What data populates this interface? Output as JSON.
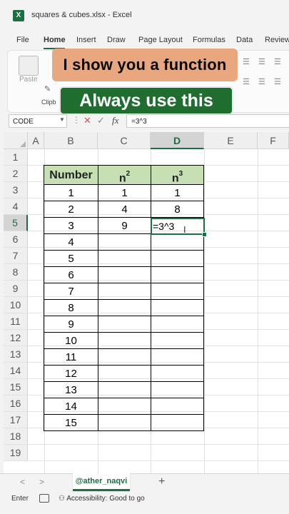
{
  "window": {
    "title": "squares & cubes.xlsx - Excel",
    "app_icon": "excel-logo-icon",
    "logo_letter": "X"
  },
  "menu": {
    "items": [
      "File",
      "Home",
      "Insert",
      "Draw",
      "Page Layout",
      "Formulas",
      "Data",
      "Review"
    ]
  },
  "ribbon": {
    "paste_label": "Paste",
    "clipboard_label": "Clipb"
  },
  "overlay": {
    "line1": "I show you a function",
    "line2": "Always use this"
  },
  "formula_bar": {
    "name_box": "CODE",
    "fx": "fx",
    "formula": "=3^3",
    "cancel": "✕",
    "enter": "✓",
    "dots": "⋮"
  },
  "columns": [
    "A",
    "B",
    "C",
    "D",
    "E",
    "F"
  ],
  "rows": [
    "1",
    "2",
    "3",
    "4",
    "5",
    "6",
    "7",
    "8",
    "9",
    "10",
    "11",
    "12",
    "13",
    "14",
    "15",
    "16",
    "17",
    "18",
    "19"
  ],
  "selected": {
    "column": "D",
    "row": "5"
  },
  "table": {
    "header": {
      "number": "Number",
      "n": "n",
      "sq_exp": "2",
      "cube_exp": "3"
    },
    "rows": [
      {
        "number": "1",
        "square": "1",
        "cube": "1"
      },
      {
        "number": "2",
        "square": "4",
        "cube": "8"
      },
      {
        "number": "3",
        "square": "9",
        "cube": ""
      },
      {
        "number": "4",
        "square": "",
        "cube": ""
      },
      {
        "number": "5",
        "square": "",
        "cube": ""
      },
      {
        "number": "6",
        "square": "",
        "cube": ""
      },
      {
        "number": "7",
        "square": "",
        "cube": ""
      },
      {
        "number": "8",
        "square": "",
        "cube": ""
      },
      {
        "number": "9",
        "square": "",
        "cube": ""
      },
      {
        "number": "10",
        "square": "",
        "cube": ""
      },
      {
        "number": "11",
        "square": "",
        "cube": ""
      },
      {
        "number": "12",
        "square": "",
        "cube": ""
      },
      {
        "number": "13",
        "square": "",
        "cube": ""
      },
      {
        "number": "14",
        "square": "",
        "cube": ""
      },
      {
        "number": "15",
        "square": "",
        "cube": ""
      }
    ]
  },
  "active_cell": {
    "value": "=3^3"
  },
  "sheets": {
    "tab": "@ather_naqvi",
    "add": "+",
    "prev": "<",
    "next": ">"
  },
  "status": {
    "mode": "Enter",
    "accessibility": "Accessibility: Good to go"
  },
  "colors": {
    "excel_green": "#1d6f42",
    "header_fill": "#c6e0b4",
    "banner_orange": "#e8a77f",
    "banner_green": "#1f6e30"
  }
}
